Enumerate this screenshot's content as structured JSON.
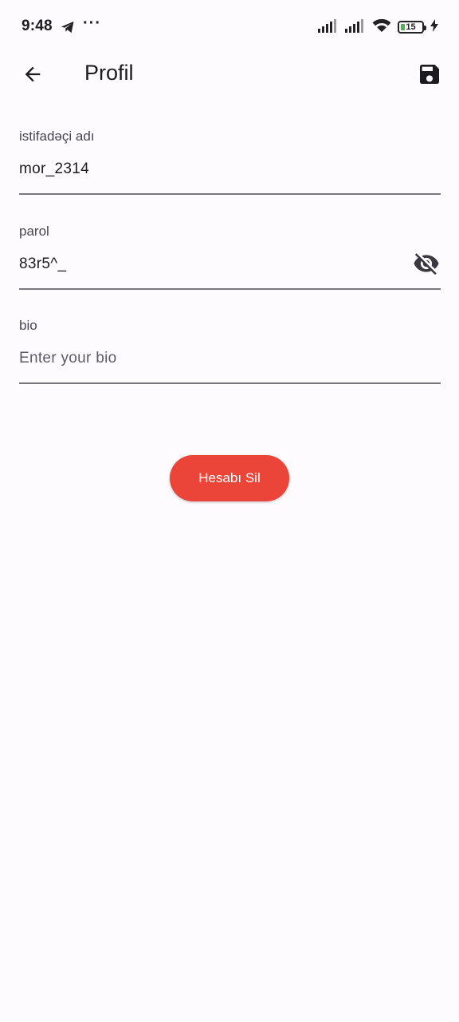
{
  "status_bar": {
    "time": "9:48",
    "battery_level": "15",
    "icons": [
      "telegram-icon",
      "more-icon",
      "signal-icon",
      "signal-icon",
      "wifi-icon",
      "battery-icon",
      "charging-icon"
    ]
  },
  "app_bar": {
    "title": "Profil",
    "back_icon": "arrow-back-icon",
    "save_icon": "save-icon"
  },
  "form": {
    "username": {
      "label": "istifadəçi adı",
      "value": "mor_2314"
    },
    "password": {
      "label": "parol",
      "value": "83r5^_",
      "toggle_icon": "visibility-off-icon"
    },
    "bio": {
      "label": "bio",
      "value": "",
      "placeholder": "Enter your bio"
    }
  },
  "actions": {
    "delete_account_label": "Hesabı Sil"
  },
  "colors": {
    "background": "#fefbfe",
    "danger": "#ea4538",
    "text": "#1c1b1f",
    "underline": "#79747e"
  }
}
